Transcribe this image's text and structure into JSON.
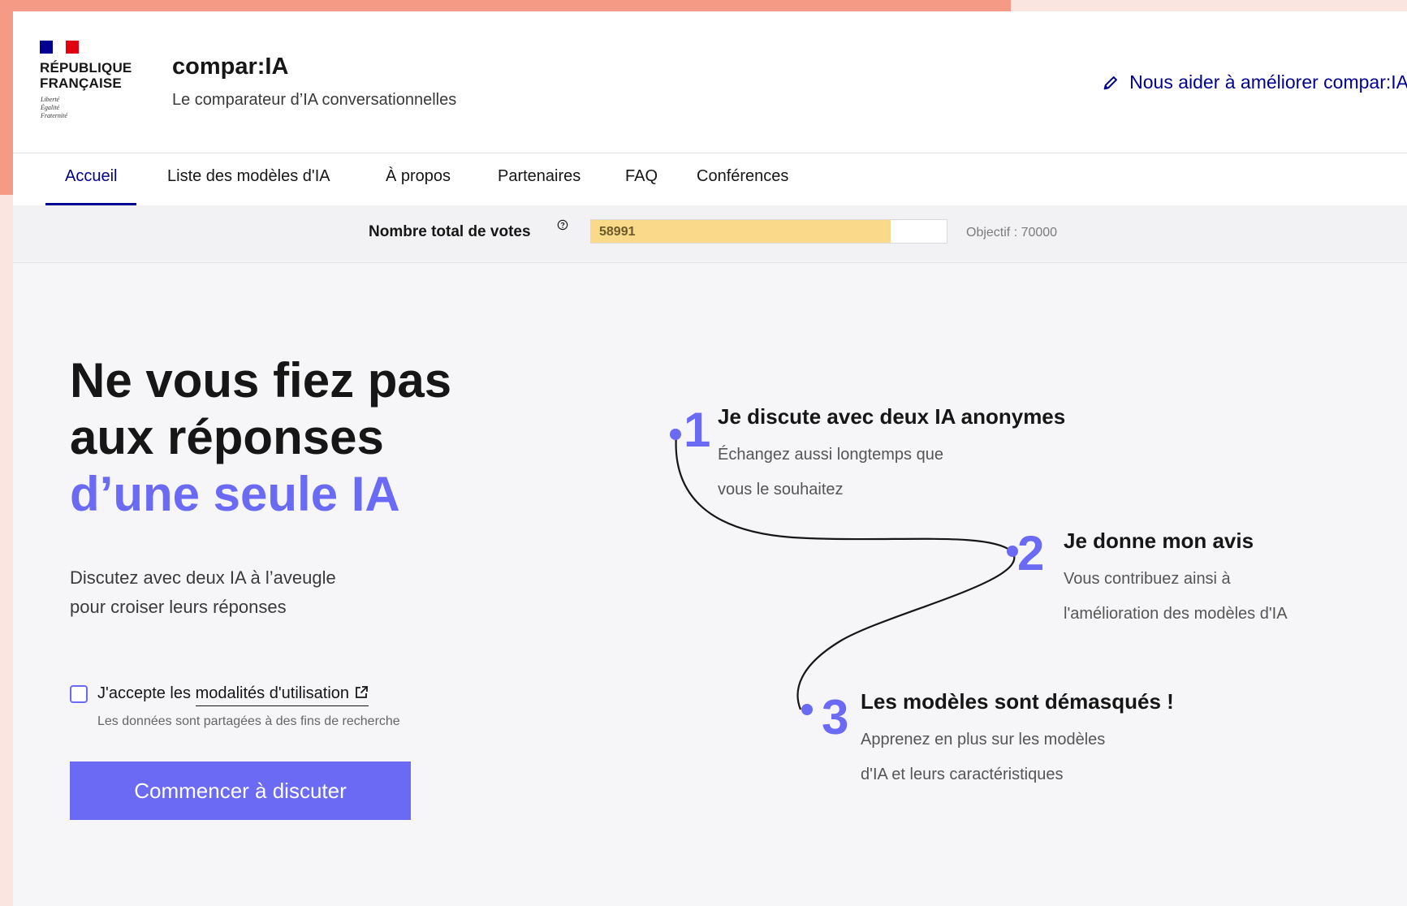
{
  "header": {
    "republique_lines": [
      "RÉPUBLIQUE",
      "FRANÇAISE"
    ],
    "devise_lines": [
      "Liberté",
      "Égalité",
      "Fraternité"
    ],
    "brand": "compar:IA",
    "tagline": "Le comparateur d’IA conversationnelles",
    "help_link": "Nous aider à améliorer compar:IA",
    "help_icon": "pencil-icon"
  },
  "nav": {
    "items": [
      {
        "label": "Accueil",
        "active": true
      },
      {
        "label": "Liste des modèles d'IA",
        "active": false
      },
      {
        "label": "À propos",
        "active": false
      },
      {
        "label": "Partenaires",
        "active": false
      },
      {
        "label": "FAQ",
        "active": false
      },
      {
        "label": "Conférences",
        "active": false
      }
    ]
  },
  "votes": {
    "label": "Nombre total de votes",
    "value": "58991",
    "objective": "Objectif : 70000",
    "progress_fraction": 0.843,
    "help_icon": "question-circle-icon"
  },
  "hero": {
    "title_lines": [
      "Ne vous fiez pas",
      "aux réponses"
    ],
    "title_accent": "d’une seule IA",
    "subtitle_lines": [
      "Discutez avec deux IA à l’aveugle",
      "pour croiser leurs réponses"
    ],
    "consent_prefix": "J'accepte les",
    "consent_link": "modalités d'utilisation",
    "consent_hint": "Les données sont partagées à des fins de recherche",
    "start_button": "Commencer à discuter"
  },
  "steps": [
    {
      "number": "1",
      "title": "Je discute avec deux IA anonymes",
      "desc_lines": [
        "Échangez aussi longtemps que",
        "vous le souhaitez"
      ]
    },
    {
      "number": "2",
      "title": "Je donne mon avis",
      "desc_lines": [
        "Vous contribuez ainsi à",
        "l'amélioration des modèles d'IA"
      ]
    },
    {
      "number": "3",
      "title": "Les modèles sont démasqués !",
      "desc_lines": [
        "Apprenez en plus sur les modèles",
        "d'IA et leurs caractéristiques"
      ]
    }
  ],
  "colors": {
    "accent": "#6a6af4",
    "blue_france": "#000091",
    "red_marianne": "#e1000f",
    "progress_fill": "#fad98a",
    "frame": "#f49a85"
  }
}
